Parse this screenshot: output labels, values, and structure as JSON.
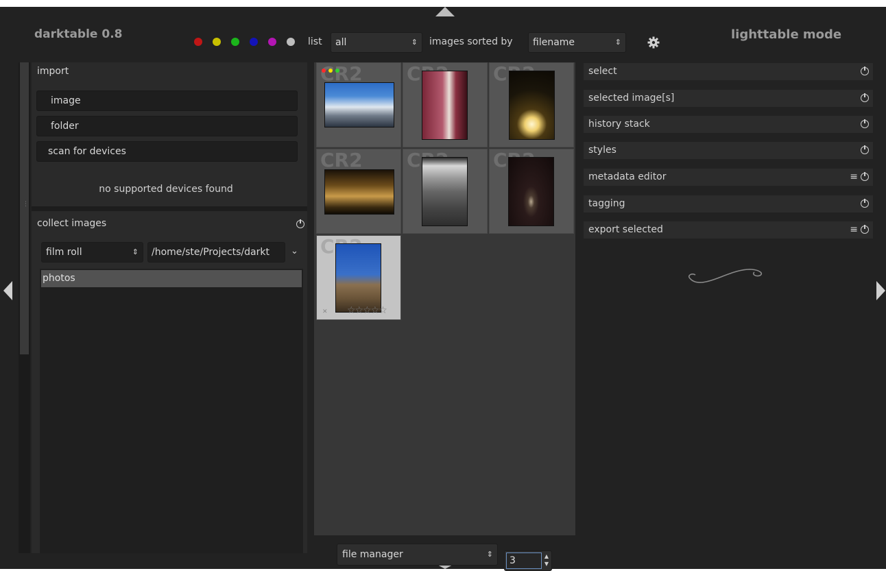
{
  "header": {
    "app_title": "darktable 0.8",
    "mode_title": "lighttable mode",
    "color_filters": [
      "#c01616",
      "#c8c000",
      "#1bb51b",
      "#1313b8",
      "#b315b3",
      "#bdbdbd"
    ],
    "list_label": "list",
    "list_value": "all",
    "sorted_label": "images sorted by",
    "sort_value": "filename"
  },
  "left": {
    "import": {
      "title": "import",
      "buttons": [
        "image",
        "folder",
        "scan for devices"
      ],
      "no_devices": "no supported devices found"
    },
    "collect": {
      "title": "collect images",
      "property": "film roll",
      "path": "/home/ste/Projects/darkt",
      "rows": [
        "photos"
      ]
    }
  },
  "center": {
    "thumbnails": [
      {
        "format": "CR2"
      },
      {
        "format": "CR2"
      },
      {
        "format": "CR2"
      },
      {
        "format": "CR2"
      },
      {
        "format": "CR2"
      },
      {
        "format": "CR2"
      },
      {
        "format": "CR2"
      }
    ],
    "rating_stars": "☆☆☆☆☆",
    "label_colors": [
      "#ff2a2a",
      "#ffe400",
      "#32d232"
    ]
  },
  "right": {
    "modules": [
      {
        "label": "select",
        "menu": false
      },
      {
        "label": "selected image[s]",
        "menu": false
      },
      {
        "label": "history stack",
        "menu": false
      },
      {
        "label": "styles",
        "menu": false
      },
      {
        "label": "metadata editor",
        "menu": true
      },
      {
        "label": "tagging",
        "menu": false
      },
      {
        "label": "export selected",
        "menu": true
      }
    ]
  },
  "bottom": {
    "layout_value": "file manager",
    "zoom_value": "3"
  }
}
